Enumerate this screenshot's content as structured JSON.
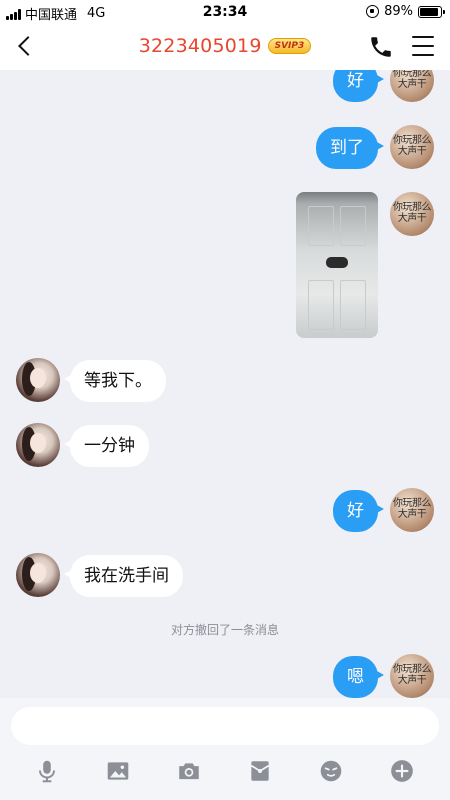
{
  "status_bar": {
    "carrier": "中国联通",
    "network": "4G",
    "time": "23:34",
    "battery": "89%",
    "battery_level": 0.89
  },
  "header": {
    "title": "3223405019",
    "badge": "SVIP3",
    "title_color": "#e8462f"
  },
  "my_avatar_text": "你玩那么\n大声干",
  "messages": [
    {
      "side": "me",
      "type": "text",
      "text": "好"
    },
    {
      "side": "me",
      "type": "text",
      "text": "到了"
    },
    {
      "side": "me",
      "type": "image",
      "text": ""
    },
    {
      "side": "her",
      "type": "text",
      "text": "等我下。"
    },
    {
      "side": "her",
      "type": "text",
      "text": "一分钟"
    },
    {
      "side": "me",
      "type": "text",
      "text": "好"
    },
    {
      "side": "her",
      "type": "text",
      "text": "我在洗手间"
    },
    {
      "side": "system",
      "type": "notice",
      "text": "对方撤回了一条消息"
    },
    {
      "side": "me",
      "type": "text",
      "text": "嗯"
    }
  ],
  "colors": {
    "bubble_me": "#2a9df4",
    "bubble_her": "#ffffff",
    "background": "#eef0f6"
  },
  "toolbar": {
    "icons": [
      "microphone-icon",
      "image-icon",
      "camera-icon",
      "red-packet-icon",
      "emoji-icon",
      "plus-icon"
    ]
  }
}
